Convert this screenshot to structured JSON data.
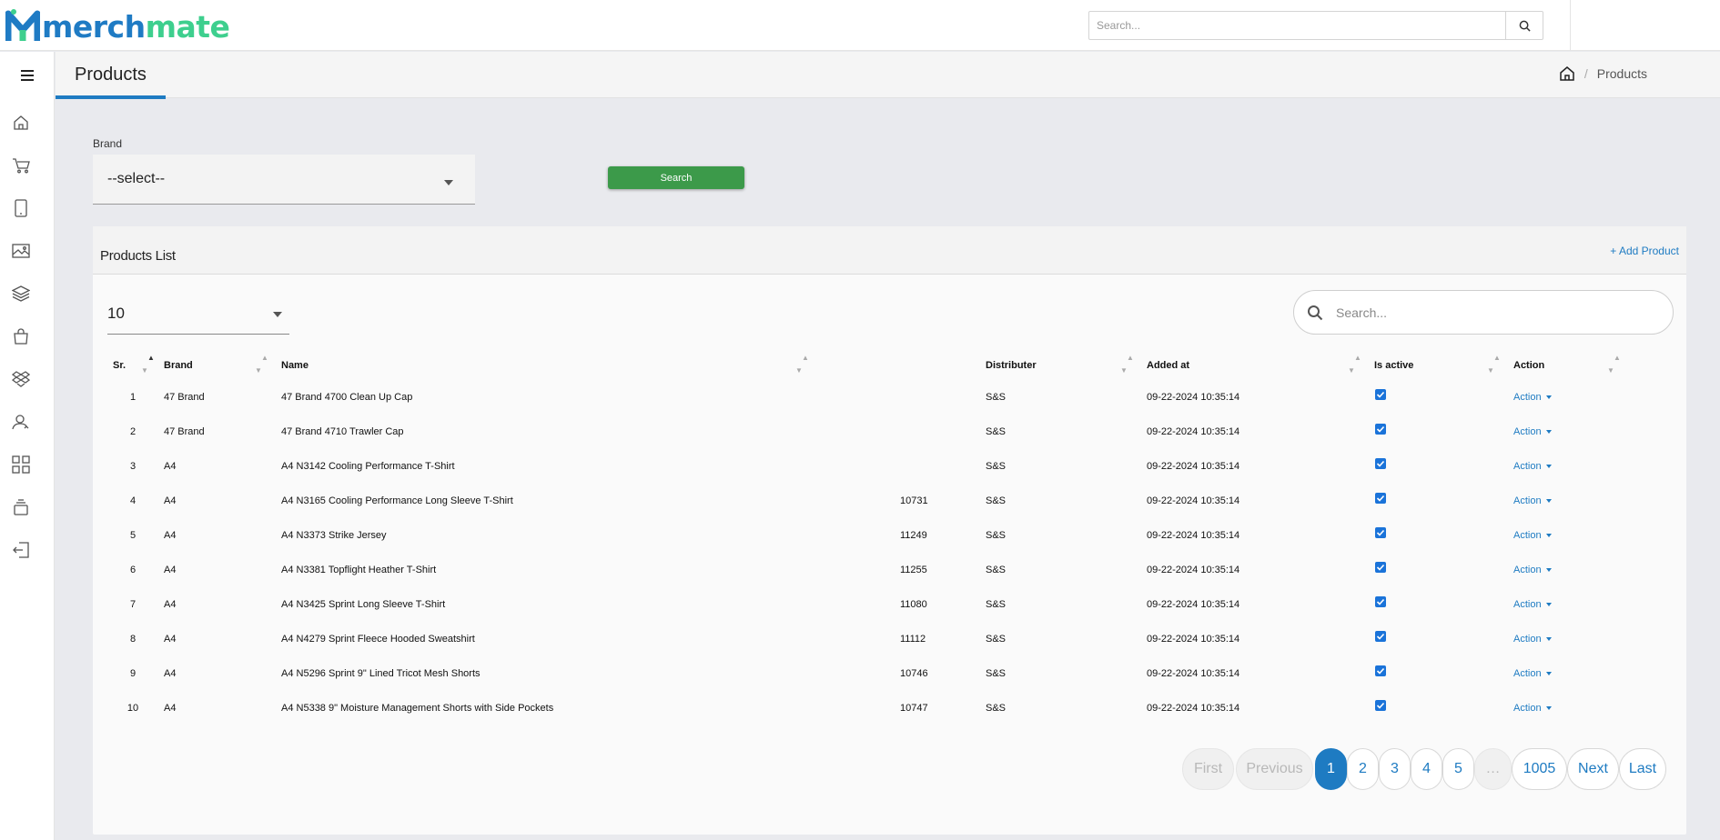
{
  "app": {
    "logo_part1": "merch",
    "logo_part2": "mate",
    "top_search_placeholder": "Search..."
  },
  "sidebar": {
    "items": [
      {
        "icon": "home-icon"
      },
      {
        "icon": "cart-icon"
      },
      {
        "icon": "tablet-icon"
      },
      {
        "icon": "image-icon"
      },
      {
        "icon": "layers-icon"
      },
      {
        "icon": "shopping-bag-icon"
      },
      {
        "icon": "dropbox-icon"
      },
      {
        "icon": "user-icon"
      },
      {
        "icon": "grid-icon"
      },
      {
        "icon": "stack-icon"
      },
      {
        "icon": "logout-icon"
      }
    ]
  },
  "header": {
    "title": "Products",
    "breadcrumb_current": "Products"
  },
  "filter": {
    "brand_label": "Brand",
    "brand_value": "--select--",
    "search_button": "Search"
  },
  "card": {
    "title": "Products List",
    "add_product": "+ Add Product",
    "page_length": "10",
    "search_placeholder": "Search..."
  },
  "table": {
    "columns": [
      "Sr.",
      "Brand",
      "Name",
      "",
      "Distributer",
      "Added at",
      "Is active",
      "Action"
    ],
    "rows": [
      {
        "sr": "1",
        "brand": "47 Brand",
        "name": "47 Brand 4700 Clean Up Cap",
        "code": "",
        "distributer": "S&S",
        "added": "09-22-2024 10:35:14",
        "active": true,
        "action": "Action"
      },
      {
        "sr": "2",
        "brand": "47 Brand",
        "name": "47 Brand 4710 Trawler Cap",
        "code": "",
        "distributer": "S&S",
        "added": "09-22-2024 10:35:14",
        "active": true,
        "action": "Action"
      },
      {
        "sr": "3",
        "brand": "A4",
        "name": "A4 N3142 Cooling Performance T-Shirt",
        "code": "",
        "distributer": "S&S",
        "added": "09-22-2024 10:35:14",
        "active": true,
        "action": "Action"
      },
      {
        "sr": "4",
        "brand": "A4",
        "name": "A4 N3165 Cooling Performance Long Sleeve T-Shirt",
        "code": "10731",
        "distributer": "S&S",
        "added": "09-22-2024 10:35:14",
        "active": true,
        "action": "Action"
      },
      {
        "sr": "5",
        "brand": "A4",
        "name": "A4 N3373 Strike Jersey",
        "code": "11249",
        "distributer": "S&S",
        "added": "09-22-2024 10:35:14",
        "active": true,
        "action": "Action"
      },
      {
        "sr": "6",
        "brand": "A4",
        "name": "A4 N3381 Topflight Heather T-Shirt",
        "code": "11255",
        "distributer": "S&S",
        "added": "09-22-2024 10:35:14",
        "active": true,
        "action": "Action"
      },
      {
        "sr": "7",
        "brand": "A4",
        "name": "A4 N3425 Sprint Long Sleeve T-Shirt",
        "code": "11080",
        "distributer": "S&S",
        "added": "09-22-2024 10:35:14",
        "active": true,
        "action": "Action"
      },
      {
        "sr": "8",
        "brand": "A4",
        "name": "A4 N4279 Sprint Fleece Hooded Sweatshirt",
        "code": "11112",
        "distributer": "S&S",
        "added": "09-22-2024 10:35:14",
        "active": true,
        "action": "Action"
      },
      {
        "sr": "9",
        "brand": "A4",
        "name": "A4 N5296 Sprint 9\" Lined Tricot Mesh Shorts",
        "code": "10746",
        "distributer": "S&S",
        "added": "09-22-2024 10:35:14",
        "active": true,
        "action": "Action"
      },
      {
        "sr": "10",
        "brand": "A4",
        "name": "A4 N5338 9\" Moisture Management Shorts with Side Pockets",
        "code": "10747",
        "distributer": "S&S",
        "added": "09-22-2024 10:35:14",
        "active": true,
        "action": "Action"
      }
    ]
  },
  "pagination": {
    "first": "First",
    "previous": "Previous",
    "pages": [
      "1",
      "2",
      "3",
      "4",
      "5"
    ],
    "ellipsis": "…",
    "last_page": "1005",
    "next": "Next",
    "last": "Last",
    "current": "1"
  },
  "colors": {
    "accent": "#1e7bc2",
    "search_button": "#3c9a4a",
    "logo_blue": "#1f7bc4",
    "logo_green": "#3ecf8e"
  }
}
